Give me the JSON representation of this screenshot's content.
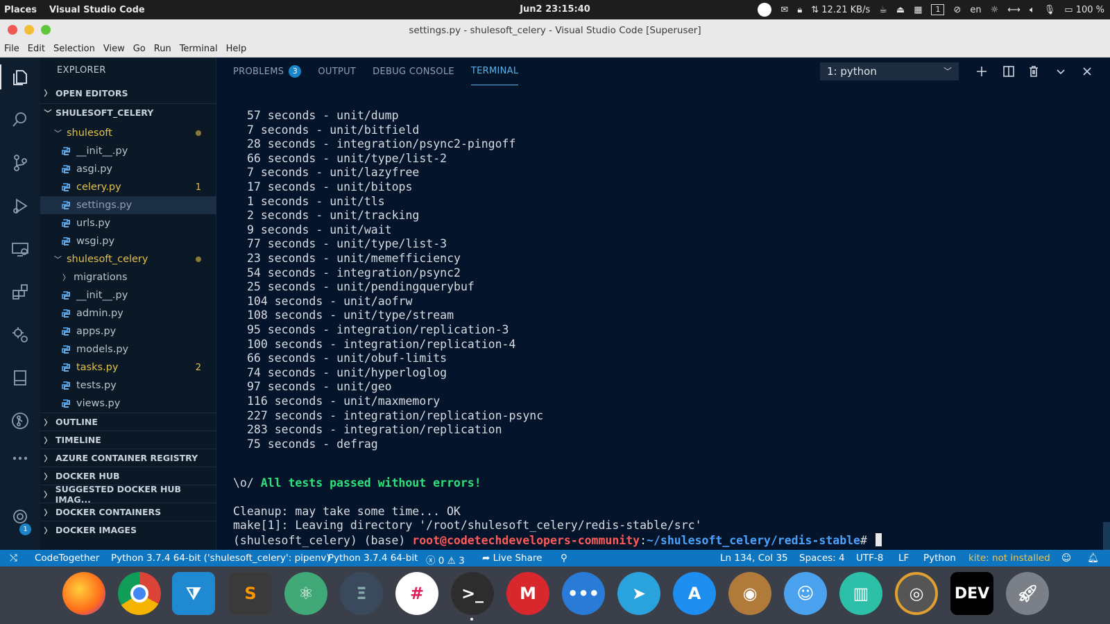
{
  "topbar": {
    "places": "Places",
    "app": "Visual Studio Code",
    "datetime": "Jun2  23:15:40",
    "netspeed": "⇅ 12.21 KB/s",
    "workspace": "1",
    "lang": "en",
    "battery": "100 %"
  },
  "window": {
    "title": "settings.py - shulesoft_celery - Visual Studio Code [Superuser]"
  },
  "menu": [
    "File",
    "Edit",
    "Selection",
    "View",
    "Go",
    "Run",
    "Terminal",
    "Help"
  ],
  "activity": {
    "settings_badge": "1"
  },
  "sidebar": {
    "header": "EXPLORER",
    "open_editors": "OPEN EDITORS",
    "project": "SHULESOFT_CELERY",
    "folder1": "shulesoft",
    "folder1_files": [
      {
        "name": "__init__.py",
        "count": ""
      },
      {
        "name": "asgi.py",
        "count": ""
      },
      {
        "name": "celery.py",
        "count": "1"
      },
      {
        "name": "settings.py",
        "count": ""
      },
      {
        "name": "urls.py",
        "count": ""
      },
      {
        "name": "wsgi.py",
        "count": ""
      }
    ],
    "folder2": "shulesoft_celery",
    "migrations": "migrations",
    "folder2_files": [
      {
        "name": "__init__.py",
        "count": ""
      },
      {
        "name": "admin.py",
        "count": ""
      },
      {
        "name": "apps.py",
        "count": ""
      },
      {
        "name": "models.py",
        "count": ""
      },
      {
        "name": "tasks.py",
        "count": "2"
      },
      {
        "name": "tests.py",
        "count": ""
      },
      {
        "name": "views.py",
        "count": ""
      }
    ],
    "sections": [
      "OUTLINE",
      "TIMELINE",
      "AZURE CONTAINER REGISTRY",
      "DOCKER HUB",
      "SUGGESTED DOCKER HUB IMAG...",
      "DOCKER CONTAINERS",
      "DOCKER IMAGES"
    ]
  },
  "panel": {
    "problems": "PROBLEMS",
    "problems_count": "3",
    "output": "OUTPUT",
    "debug": "DEBUG CONSOLE",
    "terminal": "TERMINAL",
    "terminal_select": "1: python"
  },
  "terminal": {
    "lines": [
      "57 seconds - unit/dump",
      "7 seconds - unit/bitfield",
      "28 seconds - integration/psync2-pingoff",
      "66 seconds - unit/type/list-2",
      "7 seconds - unit/lazyfree",
      "17 seconds - unit/bitops",
      "1 seconds - unit/tls",
      "2 seconds - unit/tracking",
      "9 seconds - unit/wait",
      "77 seconds - unit/type/list-3",
      "23 seconds - unit/memefficiency",
      "54 seconds - integration/psync2",
      "25 seconds - unit/pendingquerybuf",
      "104 seconds - unit/aofrw",
      "108 seconds - unit/type/stream",
      "95 seconds - integration/replication-3",
      "100 seconds - integration/replication-4",
      "66 seconds - unit/obuf-limits",
      "74 seconds - unit/hyperloglog",
      "97 seconds - unit/geo",
      "116 seconds - unit/maxmemory",
      "227 seconds - integration/replication-psync",
      "283 seconds - integration/replication",
      "75 seconds - defrag"
    ],
    "passed_prefix": "\\o/ ",
    "passed_text": "All tests passed without errors!",
    "cleanup": "Cleanup: may take some time... OK",
    "make": "make[1]: Leaving directory '/root/shulesoft_celery/redis-stable/src'",
    "prompt_env": "(shulesoft_celery) (base) ",
    "prompt_user": "root@codetechdevelopers-community",
    "prompt_colon": ":",
    "prompt_path": "~/shulesoft_celery/redis-stable",
    "prompt_hash": "# "
  },
  "status": {
    "remote": "⤭",
    "codetogether": "CodeTogether",
    "interpreter": "Python 3.7.4 64-bit ('shulesoft_celery': pipenv)",
    "python": "Python 3.7.4 64-bit",
    "errors": "ⓧ 0 ⚠ 3",
    "liveshare": "Live Share",
    "position": "Ln 134, Col 35",
    "spaces": "Spaces: 4",
    "encoding": "UTF-8",
    "eol": "LF",
    "language": "Python",
    "kite": "kite: not installed"
  },
  "colors": {
    "accent": "#0e76c0",
    "terminal_bg": "#04142a",
    "sidebar_bg": "#0b1826",
    "success": "#2ee07a",
    "prompt_user": "#ff5a5a",
    "prompt_path": "#4aa3ff"
  },
  "dock": [
    {
      "icon": "firefox-icon"
    },
    {
      "icon": "chrome-icon"
    },
    {
      "icon": "vscode-icon"
    },
    {
      "icon": "sublime-icon"
    },
    {
      "icon": "atom-icon"
    },
    {
      "icon": "gitkraken-icon"
    },
    {
      "icon": "slack-icon"
    },
    {
      "icon": "terminal-icon"
    },
    {
      "icon": "mega-icon"
    },
    {
      "icon": "chat-icon"
    },
    {
      "icon": "telegram-icon"
    },
    {
      "icon": "appstore-icon"
    },
    {
      "icon": "contacts-icon"
    },
    {
      "icon": "finder-icon"
    },
    {
      "icon": "stats-icon"
    },
    {
      "icon": "speaker-icon"
    },
    {
      "label": "DEV"
    },
    {
      "icon": "rocket-icon"
    }
  ]
}
